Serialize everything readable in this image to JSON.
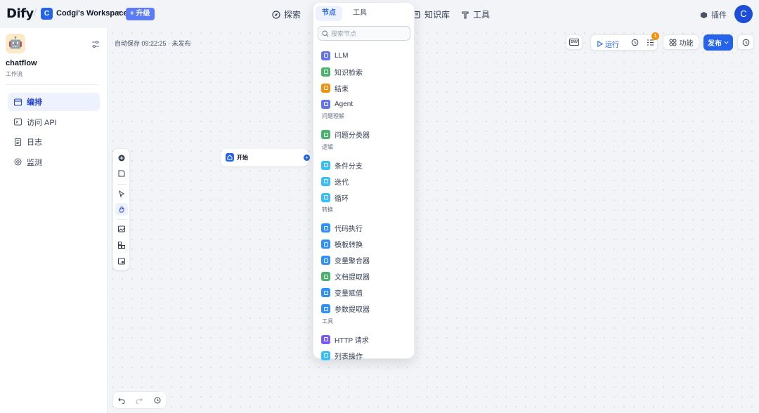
{
  "header": {
    "logo": "Dify",
    "workspace": {
      "initial": "C",
      "name": "Codgi's Workspace",
      "upgrade_label": "+ 升级"
    },
    "nav": [
      {
        "label": "探索"
      },
      {
        "label": "知识库"
      },
      {
        "label": "工具"
      }
    ],
    "plugins_label": "插件",
    "user_initial": "C"
  },
  "sidebar": {
    "app_name": "chatflow",
    "app_type": "工作流",
    "items": [
      {
        "label": "编排",
        "active": true
      },
      {
        "label": "访问 API"
      },
      {
        "label": "日志"
      },
      {
        "label": "监测"
      }
    ]
  },
  "canvas": {
    "autosave": "自动保存 09:22:25 · 未发布",
    "env_label": "ENV",
    "run_label": "运行",
    "checklist_count": "1",
    "features_label": "功能",
    "publish_label": "发布",
    "start_node_label": "开始"
  },
  "node_menu": {
    "tabs": [
      "节点",
      "工具"
    ],
    "search_placeholder": "搜索节点",
    "items": [
      {
        "label": "LLM",
        "color": "#6172f3"
      },
      {
        "label": "知识检索",
        "color": "#47b36b"
      },
      {
        "label": "结束",
        "color": "#f79009"
      },
      {
        "label": "Agent",
        "color": "#6172f3"
      },
      {
        "group": "问题理解"
      },
      {
        "label": "问题分类器",
        "color": "#47b36b"
      },
      {
        "group": "逻辑"
      },
      {
        "label": "条件分支",
        "color": "#36bffa"
      },
      {
        "label": "迭代",
        "color": "#36bffa"
      },
      {
        "label": "循环",
        "color": "#36bffa"
      },
      {
        "group": "转换"
      },
      {
        "label": "代码执行",
        "color": "#2e90fa"
      },
      {
        "label": "模板转换",
        "color": "#2e90fa"
      },
      {
        "label": "变量聚合器",
        "color": "#2e90fa"
      },
      {
        "label": "文档提取器",
        "color": "#47b36b"
      },
      {
        "label": "变量赋值",
        "color": "#2e90fa"
      },
      {
        "label": "参数提取器",
        "color": "#2e90fa"
      },
      {
        "group": "工具"
      },
      {
        "label": "HTTP 请求",
        "color": "#7a5af8"
      },
      {
        "label": "列表操作",
        "color": "#36bffa"
      }
    ]
  }
}
